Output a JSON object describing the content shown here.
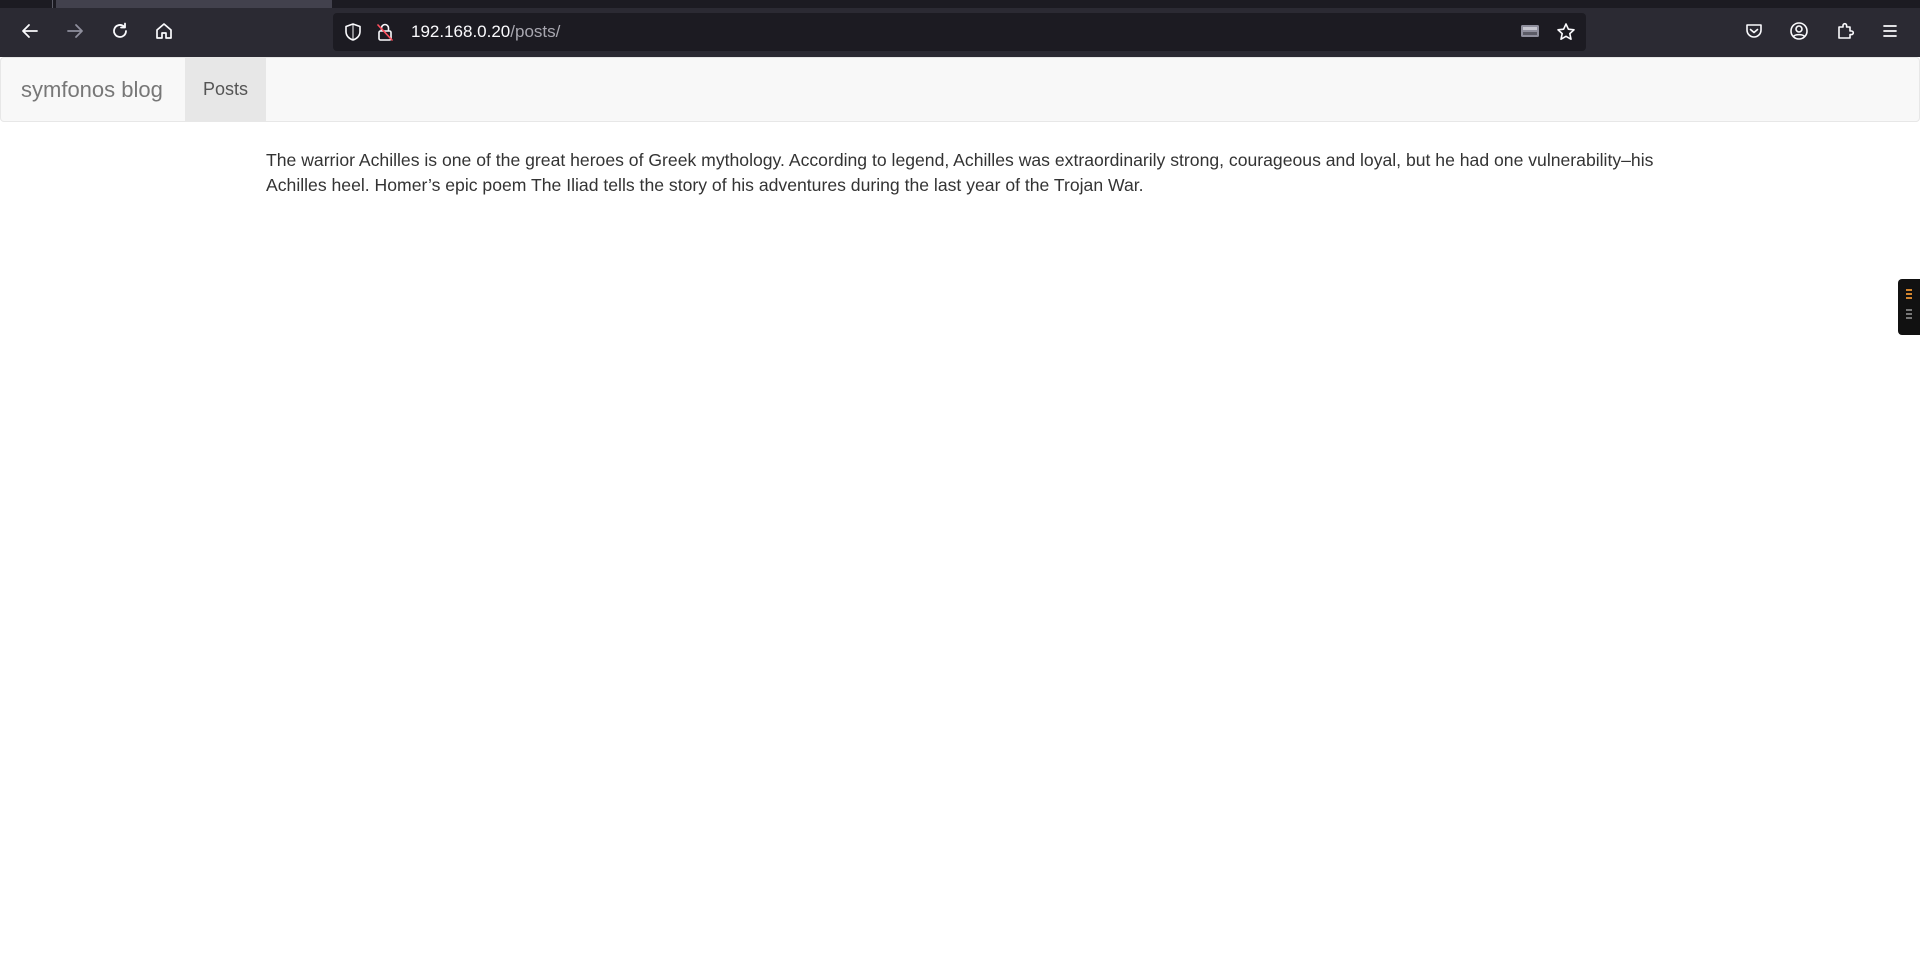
{
  "browser": {
    "url_host": "192.168.0.20",
    "url_path": "/posts/",
    "icons": {
      "back": "arrow-left-icon",
      "forward": "arrow-right-icon",
      "reload": "reload-icon",
      "home": "home-icon",
      "tracking_protection": "shield-icon",
      "insecure_connection": "lock-insecure-icon",
      "reader_view": "reader-view-icon",
      "bookmark": "star-icon",
      "pocket": "pocket-icon",
      "account": "account-icon",
      "extensions": "puzzle-icon",
      "menu": "hamburger-menu-icon"
    }
  },
  "site": {
    "brand": "symfonos blog",
    "nav_items": [
      {
        "label": "Posts",
        "active": true
      }
    ]
  },
  "post": {
    "text": "The warrior Achilles is one of the great heroes of Greek mythology. According to legend, Achilles was extraordinarily strong, courageous and loyal, but he had one vulnerability–his Achilles heel. Homer’s epic poem The Iliad tells the story of his adventures during the last year of the Trojan War."
  },
  "colors": {
    "chrome_bg": "#2b2a33",
    "urlbar_bg": "#1c1b22",
    "navbar_bg": "#f8f8f8",
    "active_nav_bg": "#e7e7e7",
    "text": "#333333"
  }
}
